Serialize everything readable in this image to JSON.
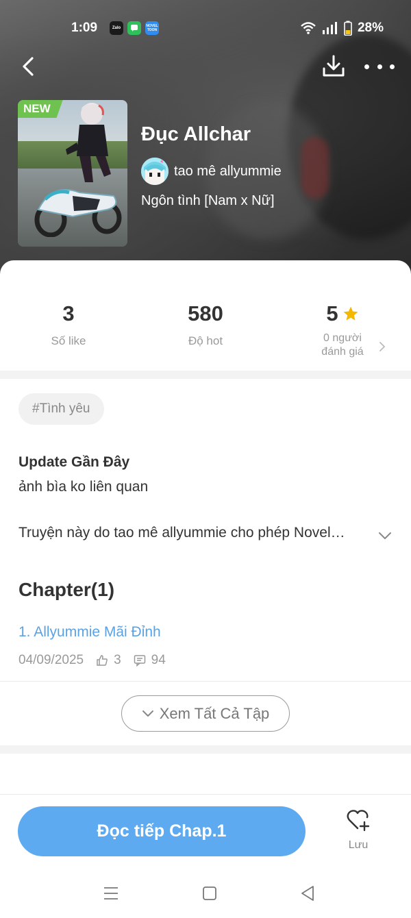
{
  "status_bar": {
    "time": "1:09",
    "apps": [
      {
        "name": "zalo-icon",
        "label": "Zalo",
        "color": "#1a1a1a"
      },
      {
        "name": "chat-icon",
        "label": "",
        "color": "#2fbf5b"
      },
      {
        "name": "noveltoon-icon",
        "label": "NOVEL TOON",
        "color": "#2f8cf0"
      }
    ],
    "battery": "28%"
  },
  "header": {
    "badge": "NEW",
    "title": "Đục Allchar",
    "author": "tao mê allyummie",
    "genre": "Ngôn tình [Nam x Nữ]"
  },
  "stats": {
    "likes": {
      "value": "3",
      "label": "Số like"
    },
    "hot": {
      "value": "580",
      "label": "Độ hot"
    },
    "rating": {
      "value": "5",
      "label_line1": "0 người",
      "label_line2": "đánh giá"
    }
  },
  "tags": [
    "#Tình yêu"
  ],
  "update": {
    "title": "Update Gần Đây",
    "body": "ảnh bìa ko liên quan"
  },
  "description": "Truyện này do tao mê allyummie  cho phép Novel…",
  "chapters": {
    "heading": "Chapter(1)",
    "items": [
      {
        "title": "1. Allyummie Mãi Đỉnh",
        "date": "04/09/2025",
        "likes": "3",
        "comments": "94"
      }
    ],
    "see_all_label": "Xem Tất Cả Tập"
  },
  "actions": {
    "read_label": "Đọc tiếp Chap.1",
    "save_label": "Lưu"
  },
  "colors": {
    "accent": "#5daaf0",
    "link": "#5aa2e4",
    "star": "#f5b800",
    "badge_new": "#6fc24f"
  }
}
